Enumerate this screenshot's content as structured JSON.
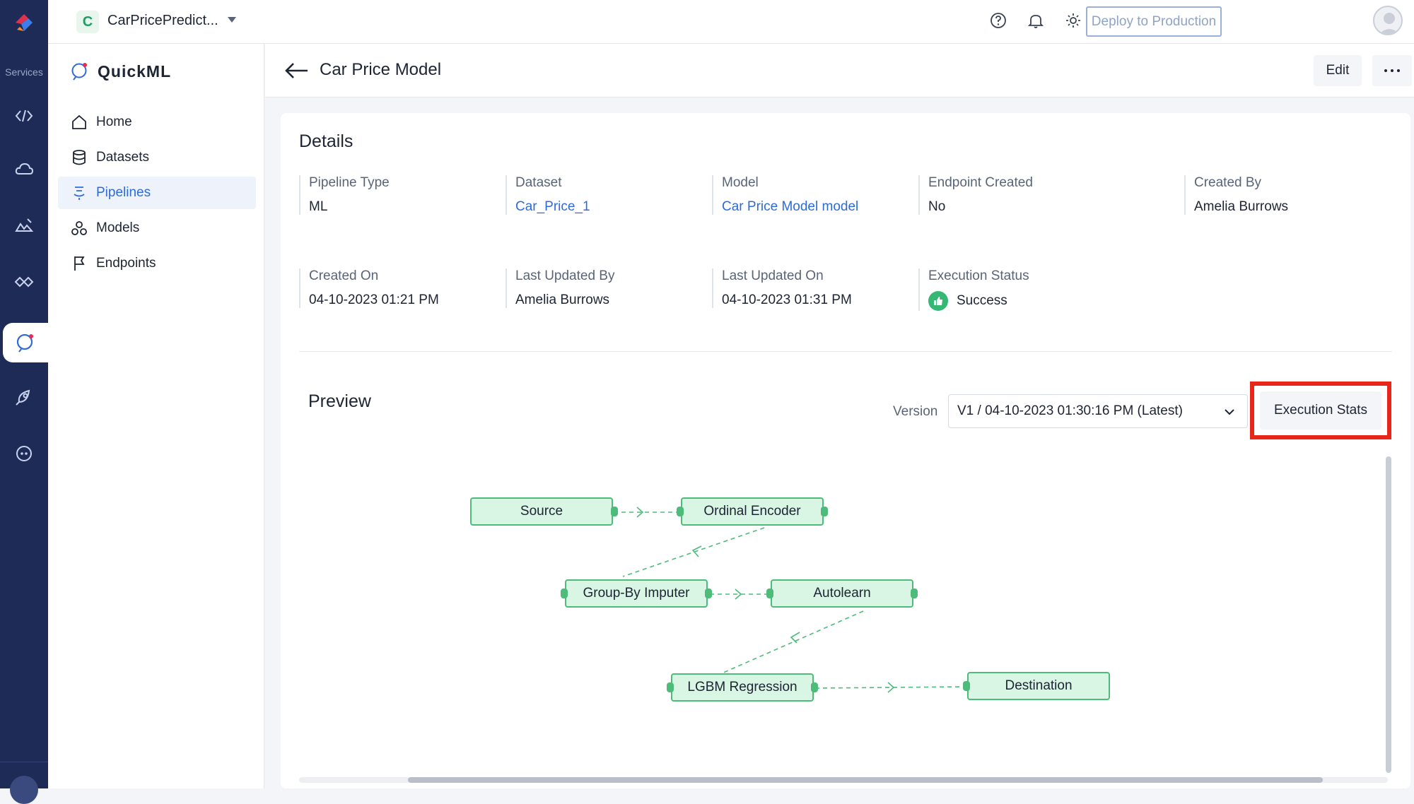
{
  "rail": {
    "services_label": "Services",
    "icons": [
      "catalyst-logo-icon",
      "code-brackets-icon",
      "cloud-icon",
      "image-edit-icon",
      "handshake-icon",
      "quickml-icon",
      "rocket-icon",
      "chatbot-icon",
      "grid-icon"
    ]
  },
  "topbar": {
    "project_initial": "C",
    "project_name": "CarPricePredict...",
    "deploy_label": "Deploy to Production"
  },
  "sidenav": {
    "brand": "QuickML",
    "items": [
      {
        "label": "Home",
        "icon": "home-icon"
      },
      {
        "label": "Datasets",
        "icon": "database-icon"
      },
      {
        "label": "Pipelines",
        "icon": "pipeline-icon"
      },
      {
        "label": "Models",
        "icon": "models-icon"
      },
      {
        "label": "Endpoints",
        "icon": "flag-icon"
      }
    ]
  },
  "header": {
    "title": "Car Price Model",
    "edit_label": "Edit"
  },
  "details": {
    "title": "Details",
    "pipeline_type": {
      "label": "Pipeline Type",
      "value": "ML"
    },
    "dataset": {
      "label": "Dataset",
      "value": "Car_Price_1"
    },
    "model": {
      "label": "Model",
      "value": "Car Price Model model"
    },
    "endpoint_created": {
      "label": "Endpoint Created",
      "value": "No"
    },
    "created_by": {
      "label": "Created By",
      "value": "Amelia Burrows"
    },
    "created_on": {
      "label": "Created On",
      "value": "04-10-2023 01:21 PM"
    },
    "last_updated_by": {
      "label": "Last Updated By",
      "value": "Amelia Burrows"
    },
    "last_updated_on": {
      "label": "Last Updated On",
      "value": "04-10-2023 01:31 PM"
    },
    "execution_status": {
      "label": "Execution Status",
      "value": "Success"
    }
  },
  "preview": {
    "title": "Preview",
    "version_label": "Version",
    "version_value": "V1 / 04-10-2023 01:30:16 PM (Latest)",
    "exec_stats_label": "Execution Stats",
    "nodes": {
      "source": "Source",
      "ordinal": "Ordinal Encoder",
      "groupby": "Group-By Imputer",
      "autolearn": "Autolearn",
      "lgbm": "LGBM Regression",
      "destination": "Destination"
    }
  },
  "colors": {
    "rail_bg": "#1e2b57",
    "accent_blue": "#2f6bd8",
    "node_fill": "#d9f5e4",
    "node_border": "#4dbb7a",
    "highlight_red": "#e8261a",
    "success_green": "#35b874"
  }
}
